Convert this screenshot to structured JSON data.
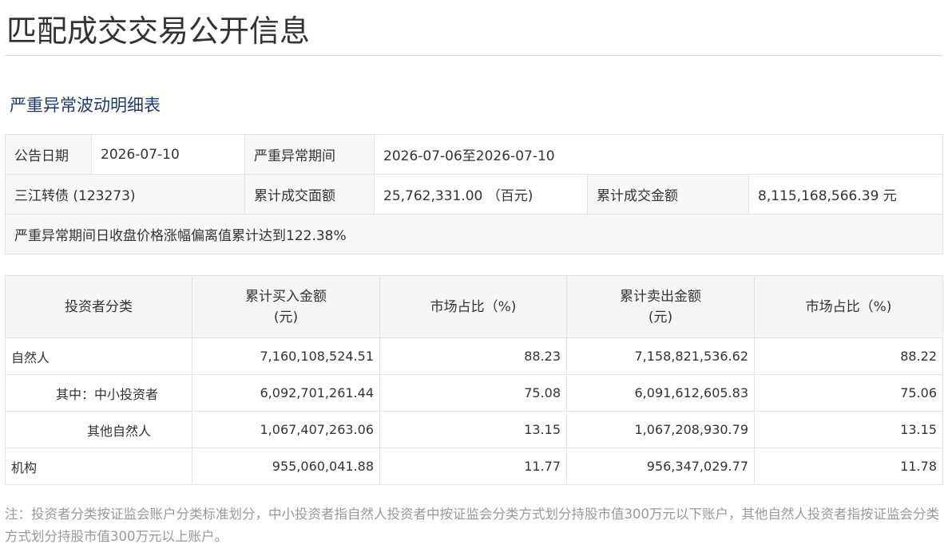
{
  "page": {
    "title": "匹配成交交易公开信息"
  },
  "section": {
    "title": "严重异常波动明细表"
  },
  "summary": {
    "announce_date_label": "公告日期",
    "announce_date_value": "2026-07-10",
    "period_label": "严重异常期间",
    "period_value": "2026-07-06至2026-07-10",
    "bond_name": "三江转债 (123273)",
    "face_amount_label": "累计成交面额",
    "face_amount_value": "25,762,331.00 （百元)",
    "trade_amount_label": "累计成交金额",
    "trade_amount_value": "8,115,168,566.39 元",
    "deviation_text": "严重异常期间日收盘价格涨幅偏离值累计达到122.38%"
  },
  "detail": {
    "headers": {
      "investor_type": "投资者分类",
      "buy_amount_line1": "累计买入金额",
      "buy_amount_line2": "(元)",
      "buy_share": "市场占比（%)",
      "sell_amount_line1": "累计卖出金额",
      "sell_amount_line2": "(元)",
      "sell_share": "市场占比（%)"
    },
    "rows": [
      {
        "type": "自然人",
        "buy": "7,160,108,524.51",
        "buy_pct": "88.23",
        "sell": "7,158,821,536.62",
        "sell_pct": "88.22"
      },
      {
        "type": "其中：中小投资者",
        "buy": "6,092,701,261.44",
        "buy_pct": "75.08",
        "sell": "6,091,612,605.83",
        "sell_pct": "75.06"
      },
      {
        "type": "其他自然人",
        "buy": "1,067,407,263.06",
        "buy_pct": "13.15",
        "sell": "1,067,208,930.79",
        "sell_pct": "13.15"
      },
      {
        "type": "机构",
        "buy": "955,060,041.88",
        "buy_pct": "11.77",
        "sell": "956,347,029.77",
        "sell_pct": "11.78"
      }
    ]
  },
  "note": {
    "text": "注：投资者分类按证监会账户分类标准划分，中小投资者指自然人投资者中按证监会分类方式划分持股市值300万元以下账户，其他自然人投资者指按证监会分类方式划分持股市值300万元以上账户。"
  }
}
